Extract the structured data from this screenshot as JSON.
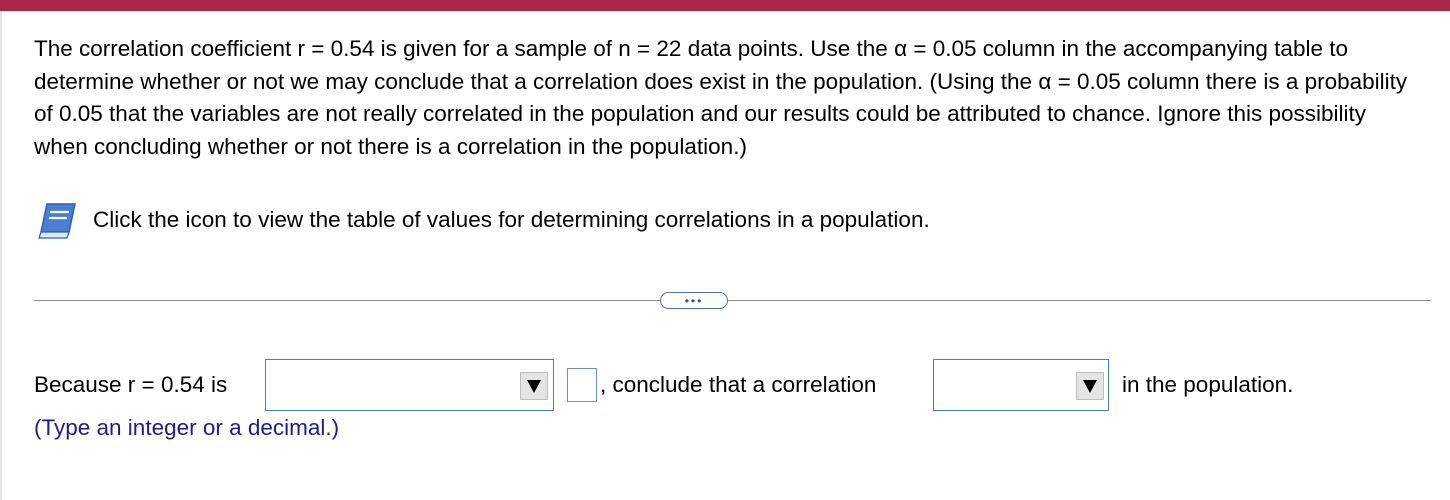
{
  "question": {
    "text": "The correlation coefficient r = 0.54 is given for a sample of n = 22 data points. Use the α = 0.05 column in the accompanying table to determine whether or not we may conclude that a correlation does exist in the population. (Using the α = 0.05 column there is a probability of 0.05 that the variables are not really correlated in the population and our results could be attributed to chance. Ignore this possibility when concluding whether or not there is a correlation in the population.)"
  },
  "table_link": {
    "icon": "book-icon",
    "text": "Click the icon to view the table of values for determining correlations in a population."
  },
  "more_button": {
    "label": "•••"
  },
  "answer": {
    "prefix": "Because r = 0.54 is",
    "dropdown1_value": "",
    "number_value": "",
    "middle": ", conclude that a correlation",
    "dropdown2_value": "",
    "suffix": "in the population."
  },
  "hint": "(Type an integer or a decimal.)",
  "colors": {
    "top_bar": "#a6274b",
    "input_border": "#4f79c4",
    "hint_text": "#1e1e8a",
    "book_icon": "#4a7fd6"
  }
}
